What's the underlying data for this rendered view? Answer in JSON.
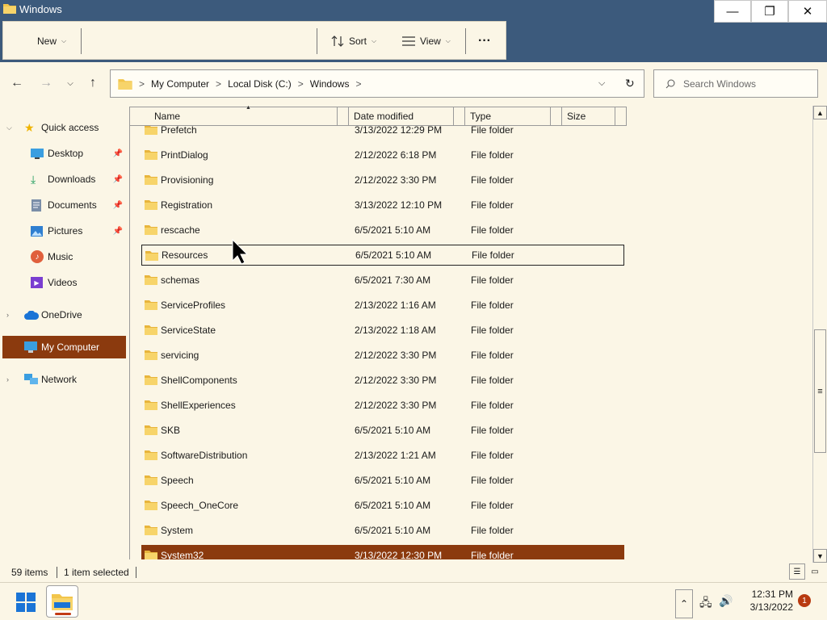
{
  "window": {
    "title": "Windows",
    "min_label": "—",
    "max_label": "❐",
    "close_label": "✕"
  },
  "ribbon": {
    "new_label": "New",
    "sort_label": "Sort",
    "view_label": "View",
    "more_label": "···"
  },
  "address": {
    "crumbs": [
      "My Computer",
      "Local Disk (C:)",
      "Windows"
    ],
    "separator": ">"
  },
  "search": {
    "placeholder": "Search Windows"
  },
  "sidebar": {
    "quick_access": "Quick access",
    "items": [
      {
        "label": "Desktop",
        "icon": "desktop-icon",
        "pinned": true
      },
      {
        "label": "Downloads",
        "icon": "downloads-icon",
        "pinned": true
      },
      {
        "label": "Documents",
        "icon": "documents-icon",
        "pinned": true
      },
      {
        "label": "Pictures",
        "icon": "pictures-icon",
        "pinned": true
      },
      {
        "label": "Music",
        "icon": "music-icon",
        "pinned": false
      },
      {
        "label": "Videos",
        "icon": "videos-icon",
        "pinned": false
      }
    ],
    "onedrive": "OneDrive",
    "my_computer": "My Computer",
    "network": "Network"
  },
  "columns": {
    "name": "Name",
    "date": "Date modified",
    "type": "Type",
    "size": "Size"
  },
  "files": [
    {
      "name": "Prefetch",
      "date": "3/13/2022 12:29 PM",
      "type": "File folder"
    },
    {
      "name": "PrintDialog",
      "date": "2/12/2022 6:18 PM",
      "type": "File folder"
    },
    {
      "name": "Provisioning",
      "date": "2/12/2022 3:30 PM",
      "type": "File folder"
    },
    {
      "name": "Registration",
      "date": "3/13/2022 12:10 PM",
      "type": "File folder"
    },
    {
      "name": "rescache",
      "date": "6/5/2021 5:10 AM",
      "type": "File folder"
    },
    {
      "name": "Resources",
      "date": "6/5/2021 5:10 AM",
      "type": "File folder"
    },
    {
      "name": "schemas",
      "date": "6/5/2021 7:30 AM",
      "type": "File folder"
    },
    {
      "name": "ServiceProfiles",
      "date": "2/13/2022 1:16 AM",
      "type": "File folder"
    },
    {
      "name": "ServiceState",
      "date": "2/13/2022 1:18 AM",
      "type": "File folder"
    },
    {
      "name": "servicing",
      "date": "2/12/2022 3:30 PM",
      "type": "File folder"
    },
    {
      "name": "ShellComponents",
      "date": "2/12/2022 3:30 PM",
      "type": "File folder"
    },
    {
      "name": "ShellExperiences",
      "date": "2/12/2022 3:30 PM",
      "type": "File folder"
    },
    {
      "name": "SKB",
      "date": "6/5/2021 5:10 AM",
      "type": "File folder"
    },
    {
      "name": "SoftwareDistribution",
      "date": "2/13/2022 1:21 AM",
      "type": "File folder"
    },
    {
      "name": "Speech",
      "date": "6/5/2021 5:10 AM",
      "type": "File folder"
    },
    {
      "name": "Speech_OneCore",
      "date": "6/5/2021 5:10 AM",
      "type": "File folder"
    },
    {
      "name": "System",
      "date": "6/5/2021 5:10 AM",
      "type": "File folder"
    },
    {
      "name": "System32",
      "date": "3/13/2022 12:30 PM",
      "type": "File folder"
    }
  ],
  "focused_row": "Resources",
  "selected_row": "System32",
  "status": {
    "item_count": "59 items",
    "selection": "1 item selected"
  },
  "taskbar": {
    "time": "12:31 PM",
    "date": "3/13/2022",
    "notifications": "1"
  },
  "colors": {
    "titlebar": "#3c5a7c",
    "background": "#fbf6e6",
    "selection": "#8b3a0e",
    "folder": "#f2c54b"
  }
}
